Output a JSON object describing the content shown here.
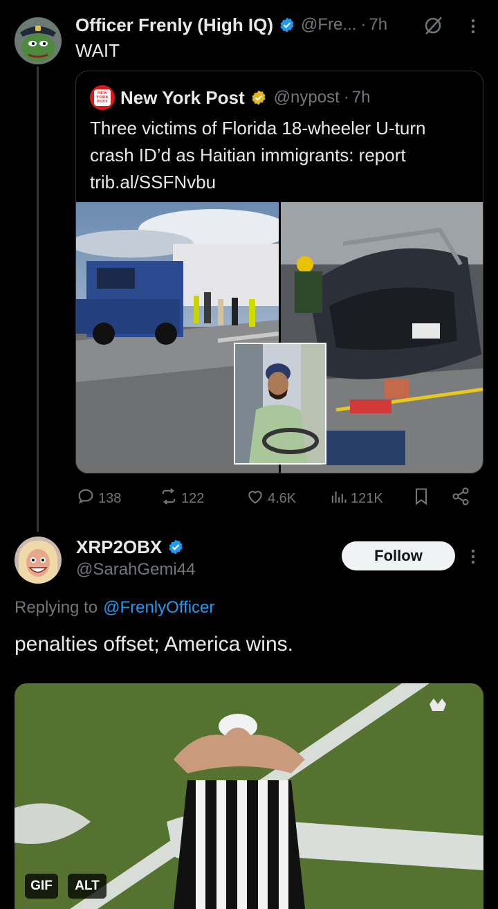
{
  "post": {
    "author_name": "Officer Frenly (High IQ)",
    "handle": "@Fre...",
    "separator": "·",
    "time": "7h",
    "text": "WAIT"
  },
  "quoted": {
    "author_name": "New York Post",
    "handle": "@nypost",
    "separator": "·",
    "time": "7h",
    "text": "Three victims of Florida 18-wheeler U-turn crash ID’d as Haitian immigrants: report trib.al/SSFNvbu",
    "logo_text": "NEW YORK POST"
  },
  "actions": {
    "replies": "138",
    "reposts": "122",
    "likes": "4.6K",
    "views": "121K"
  },
  "reply": {
    "author_name": "XRP2OBX",
    "handle": "@SarahGemi44",
    "follow_label": "Follow",
    "replying_prefix": "Replying to",
    "replying_to": "@FrenlyOfficer",
    "text": "penalties offset; America wins.",
    "gif_badge": "GIF",
    "alt_badge": "ALT"
  },
  "colors": {
    "background": "#000000",
    "accent_blue": "#1d9bf0",
    "verified_gold": "#e2b719",
    "nypost_red": "#d91a1a"
  },
  "icons": [
    "grok-icon",
    "more-icon",
    "verified-badge-icon",
    "reply-icon",
    "repost-icon",
    "like-icon",
    "views-icon",
    "bookmark-icon",
    "share-icon"
  ]
}
